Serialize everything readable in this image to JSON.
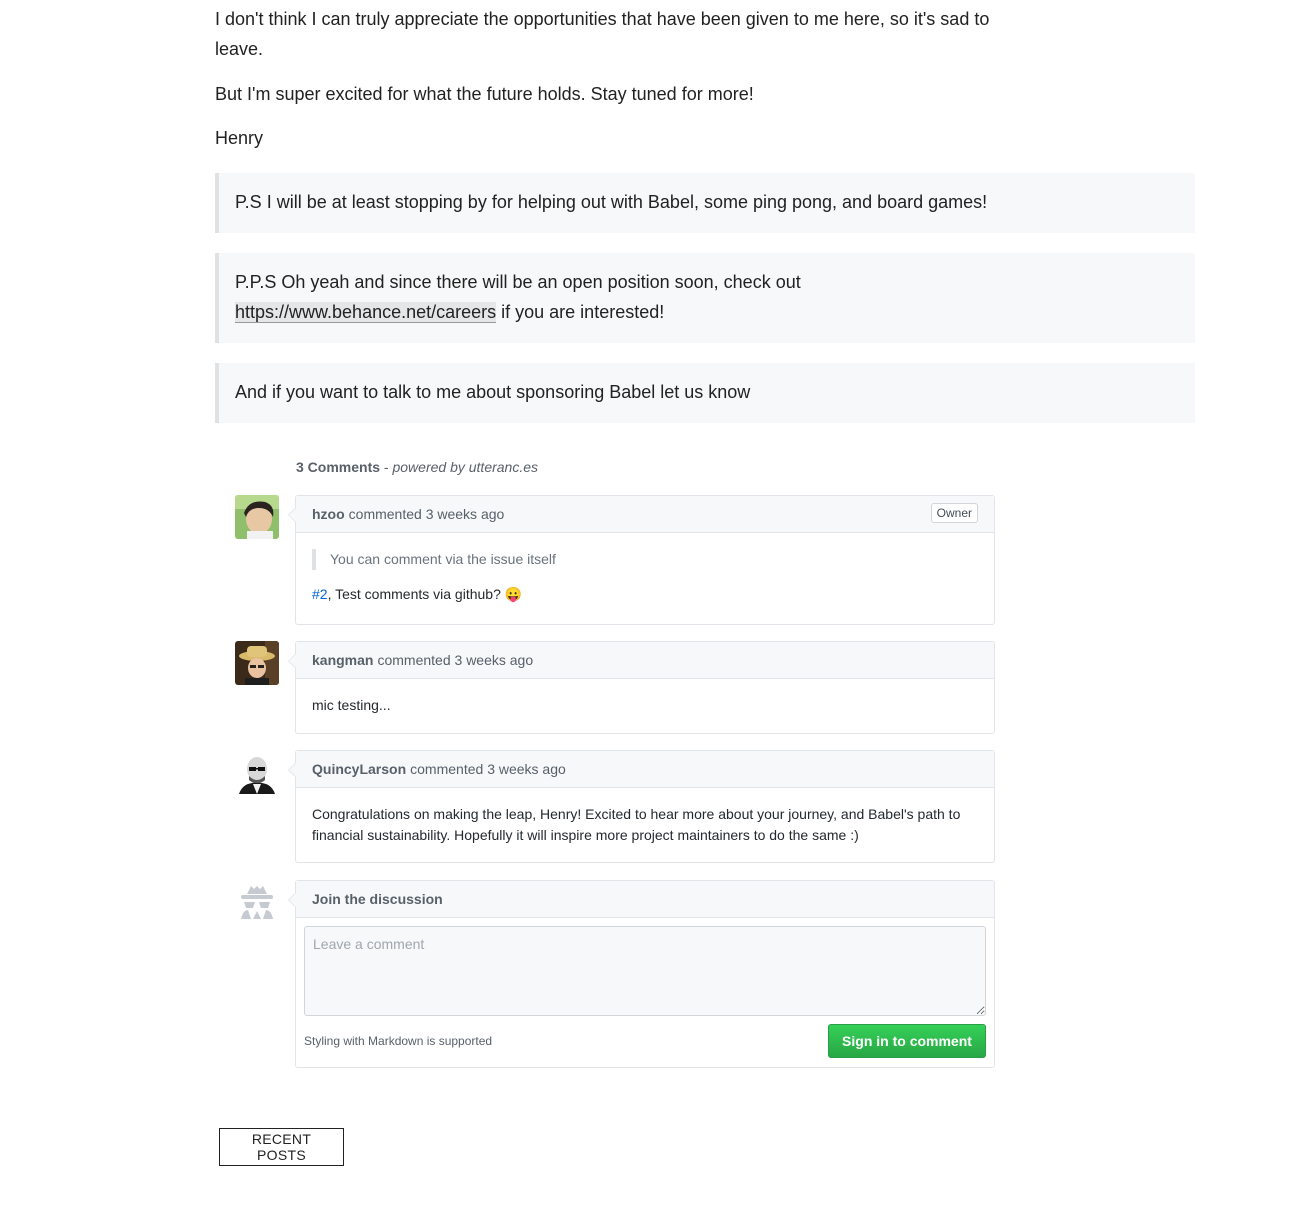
{
  "article": {
    "p1": "I don't think I can truly appreciate the opportunities that have been given to me here, so it's sad to leave.",
    "p2": "But I'm super excited for what the future holds. Stay tuned for more!",
    "signature": "Henry",
    "ps1": "P.S I will be at least stopping by for helping out with Babel, some ping pong, and board games!",
    "ps2_before": "P.P.S Oh yeah and since there will be an open position soon, check out",
    "ps2_link": "https://www.behance.net/careers",
    "ps2_after": " if you are interested!",
    "ps3": "And if you want to talk to me about sponsoring Babel let us know"
  },
  "comments": {
    "count_label": "3 Comments",
    "separator": " - ",
    "powered_label": "powered by utteranc.es",
    "items": [
      {
        "author": "hzoo",
        "action": "commented",
        "time": "3 weeks ago",
        "badge": "Owner",
        "quote": "You can comment via the issue itself",
        "issue_link": "#2",
        "body": ", Test comments via github? ",
        "emoji": "😛"
      },
      {
        "author": "kangman",
        "action": "commented",
        "time": "3 weeks ago",
        "body": "mic testing..."
      },
      {
        "author": "QuincyLarson",
        "action": "commented",
        "time": "3 weeks ago",
        "body": "Congratulations on making the leap, Henry! Excited to hear more about your journey, and Babel's path to financial sustainability. Hopefully it will inspire more project maintainers to do the same :)"
      }
    ],
    "new_comment": {
      "title": "Join the discussion",
      "placeholder": "Leave a comment",
      "markdown_note": "Styling with Markdown is supported",
      "submit_label": "Sign in to comment"
    }
  },
  "recent_posts_label": "RECENT POSTS",
  "colors": {
    "accent_green": "#28a745",
    "link_blue": "#0366d6",
    "quote_bg": "#f7f8f9"
  },
  "icons": {
    "anonymous_avatar": "incognito-icon"
  }
}
